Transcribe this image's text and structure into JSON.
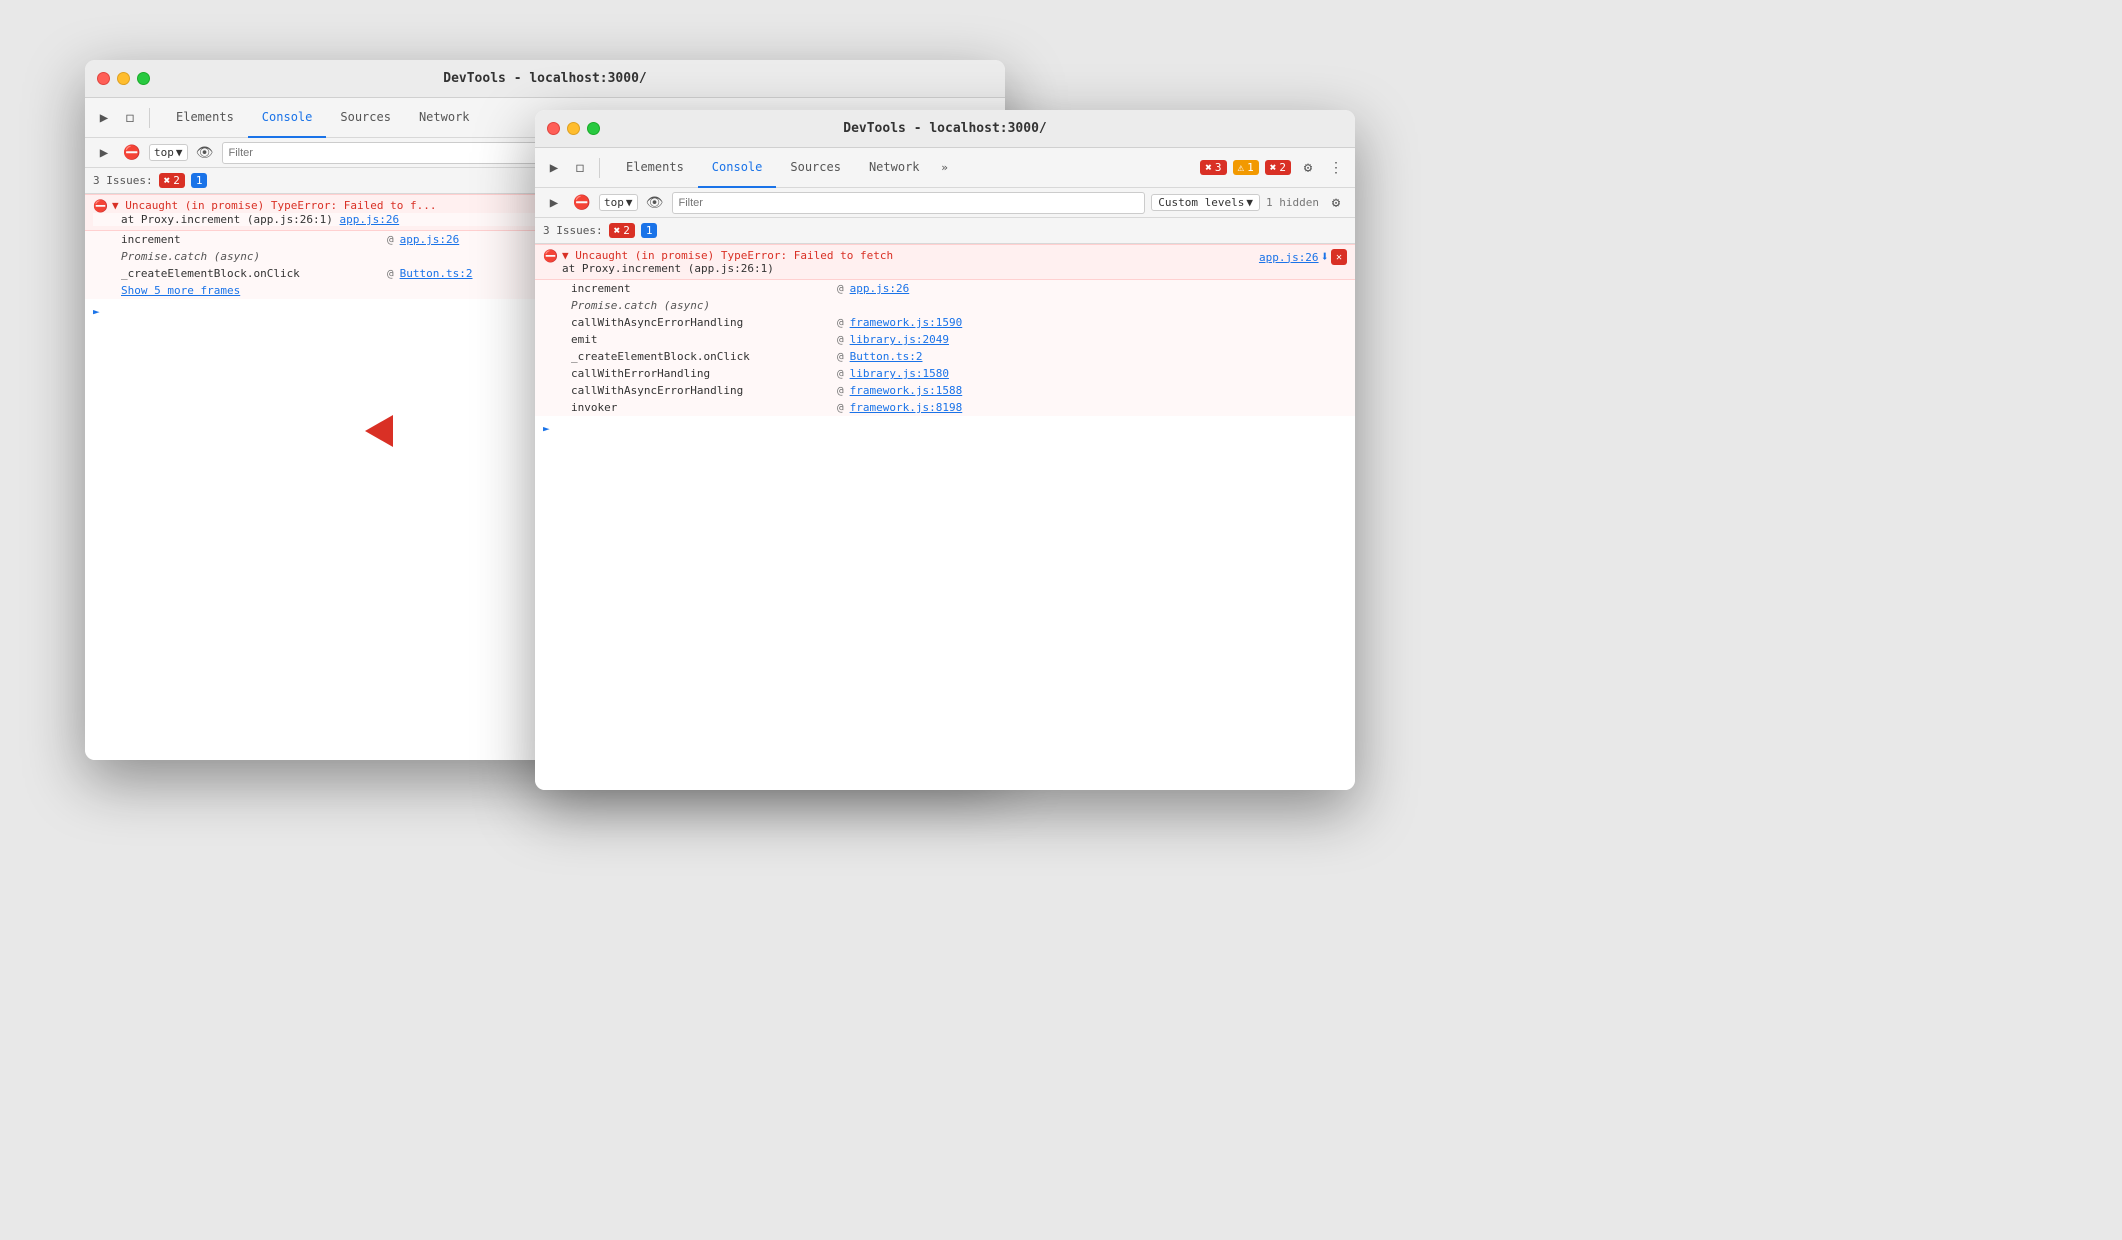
{
  "window_back": {
    "title": "DevTools - localhost:3000/",
    "tabs": [
      {
        "label": "Elements",
        "active": false
      },
      {
        "label": "Console",
        "active": true
      },
      {
        "label": "Sources",
        "active": false
      },
      {
        "label": "Network",
        "active": false
      }
    ],
    "toolbar": {
      "top_label": "top",
      "filter_placeholder": "Filter"
    },
    "issues": {
      "label": "3 Issues:",
      "error_count": "2",
      "info_count": "1"
    },
    "console_error": {
      "main_line": "▼ Uncaught (in promise) TypeError: Failed to f...",
      "second_line": "at Proxy.increment (app.js:26:1)",
      "link1": "app.js:26",
      "stack": [
        {
          "func": "increment",
          "at": "@",
          "link": "app.js:26",
          "italic": false
        },
        {
          "func": "Promise.catch (async)",
          "at": "",
          "link": "",
          "italic": true
        },
        {
          "func": "_createElementBlock.onClick",
          "at": "@",
          "link": "Button.ts:2",
          "italic": false
        }
      ],
      "show_more": "Show 5 more frames"
    }
  },
  "window_front": {
    "title": "DevTools - localhost:3000/",
    "tabs": [
      {
        "label": "Elements",
        "active": false
      },
      {
        "label": "Console",
        "active": true
      },
      {
        "label": "Sources",
        "active": false
      },
      {
        "label": "Network",
        "active": false
      }
    ],
    "toolbar": {
      "top_label": "top",
      "filter_placeholder": "Filter",
      "custom_levels": "Custom levels",
      "hidden_label": "1 hidden"
    },
    "badges": {
      "error_count": "3",
      "warning_count": "1",
      "error2_count": "2"
    },
    "issues": {
      "label": "3 Issues:",
      "error_count": "2",
      "info_count": "1"
    },
    "console_error": {
      "main_line": "▼ Uncaught (in promise) TypeError: Failed to fetch",
      "second_line": "at Proxy.increment (app.js:26:1)",
      "link1": "app.js:26",
      "stack": [
        {
          "func": "increment",
          "at": "@",
          "link": "app.js:26",
          "italic": false
        },
        {
          "func": "Promise.catch (async)",
          "at": "",
          "link": "",
          "italic": true
        },
        {
          "func": "callWithAsyncErrorHandling",
          "at": "@",
          "link": "framework.js:1590",
          "italic": false
        },
        {
          "func": "emit",
          "at": "@",
          "link": "library.js:2049",
          "italic": false
        },
        {
          "func": "_createElementBlock.onClick",
          "at": "@",
          "link": "Button.ts:2",
          "italic": false
        },
        {
          "func": "callWithErrorHandling",
          "at": "@",
          "link": "library.js:1580",
          "italic": false
        },
        {
          "func": "callWithAsyncErrorHandling",
          "at": "@",
          "link": "framework.js:1588",
          "italic": false
        },
        {
          "func": "invoker",
          "at": "@",
          "link": "framework.js:8198",
          "italic": false
        }
      ]
    }
  },
  "arrow": {
    "symbol": "➤"
  }
}
